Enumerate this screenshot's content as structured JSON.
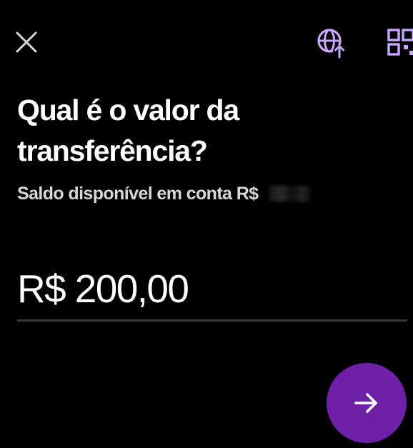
{
  "header": {
    "close_icon": "close-icon",
    "international_icon": "globe-upload-icon",
    "qr_icon": "qr-code-icon",
    "accent_color": "#c9a6ff"
  },
  "main": {
    "title": "Qual é o valor da transferência?",
    "balance_label": "Saldo disponível em conta R$",
    "balance_value": "",
    "amount": "R$ 200,00"
  },
  "footer": {
    "next_icon": "arrow-right-icon",
    "button_color": "#6f1fa8"
  }
}
